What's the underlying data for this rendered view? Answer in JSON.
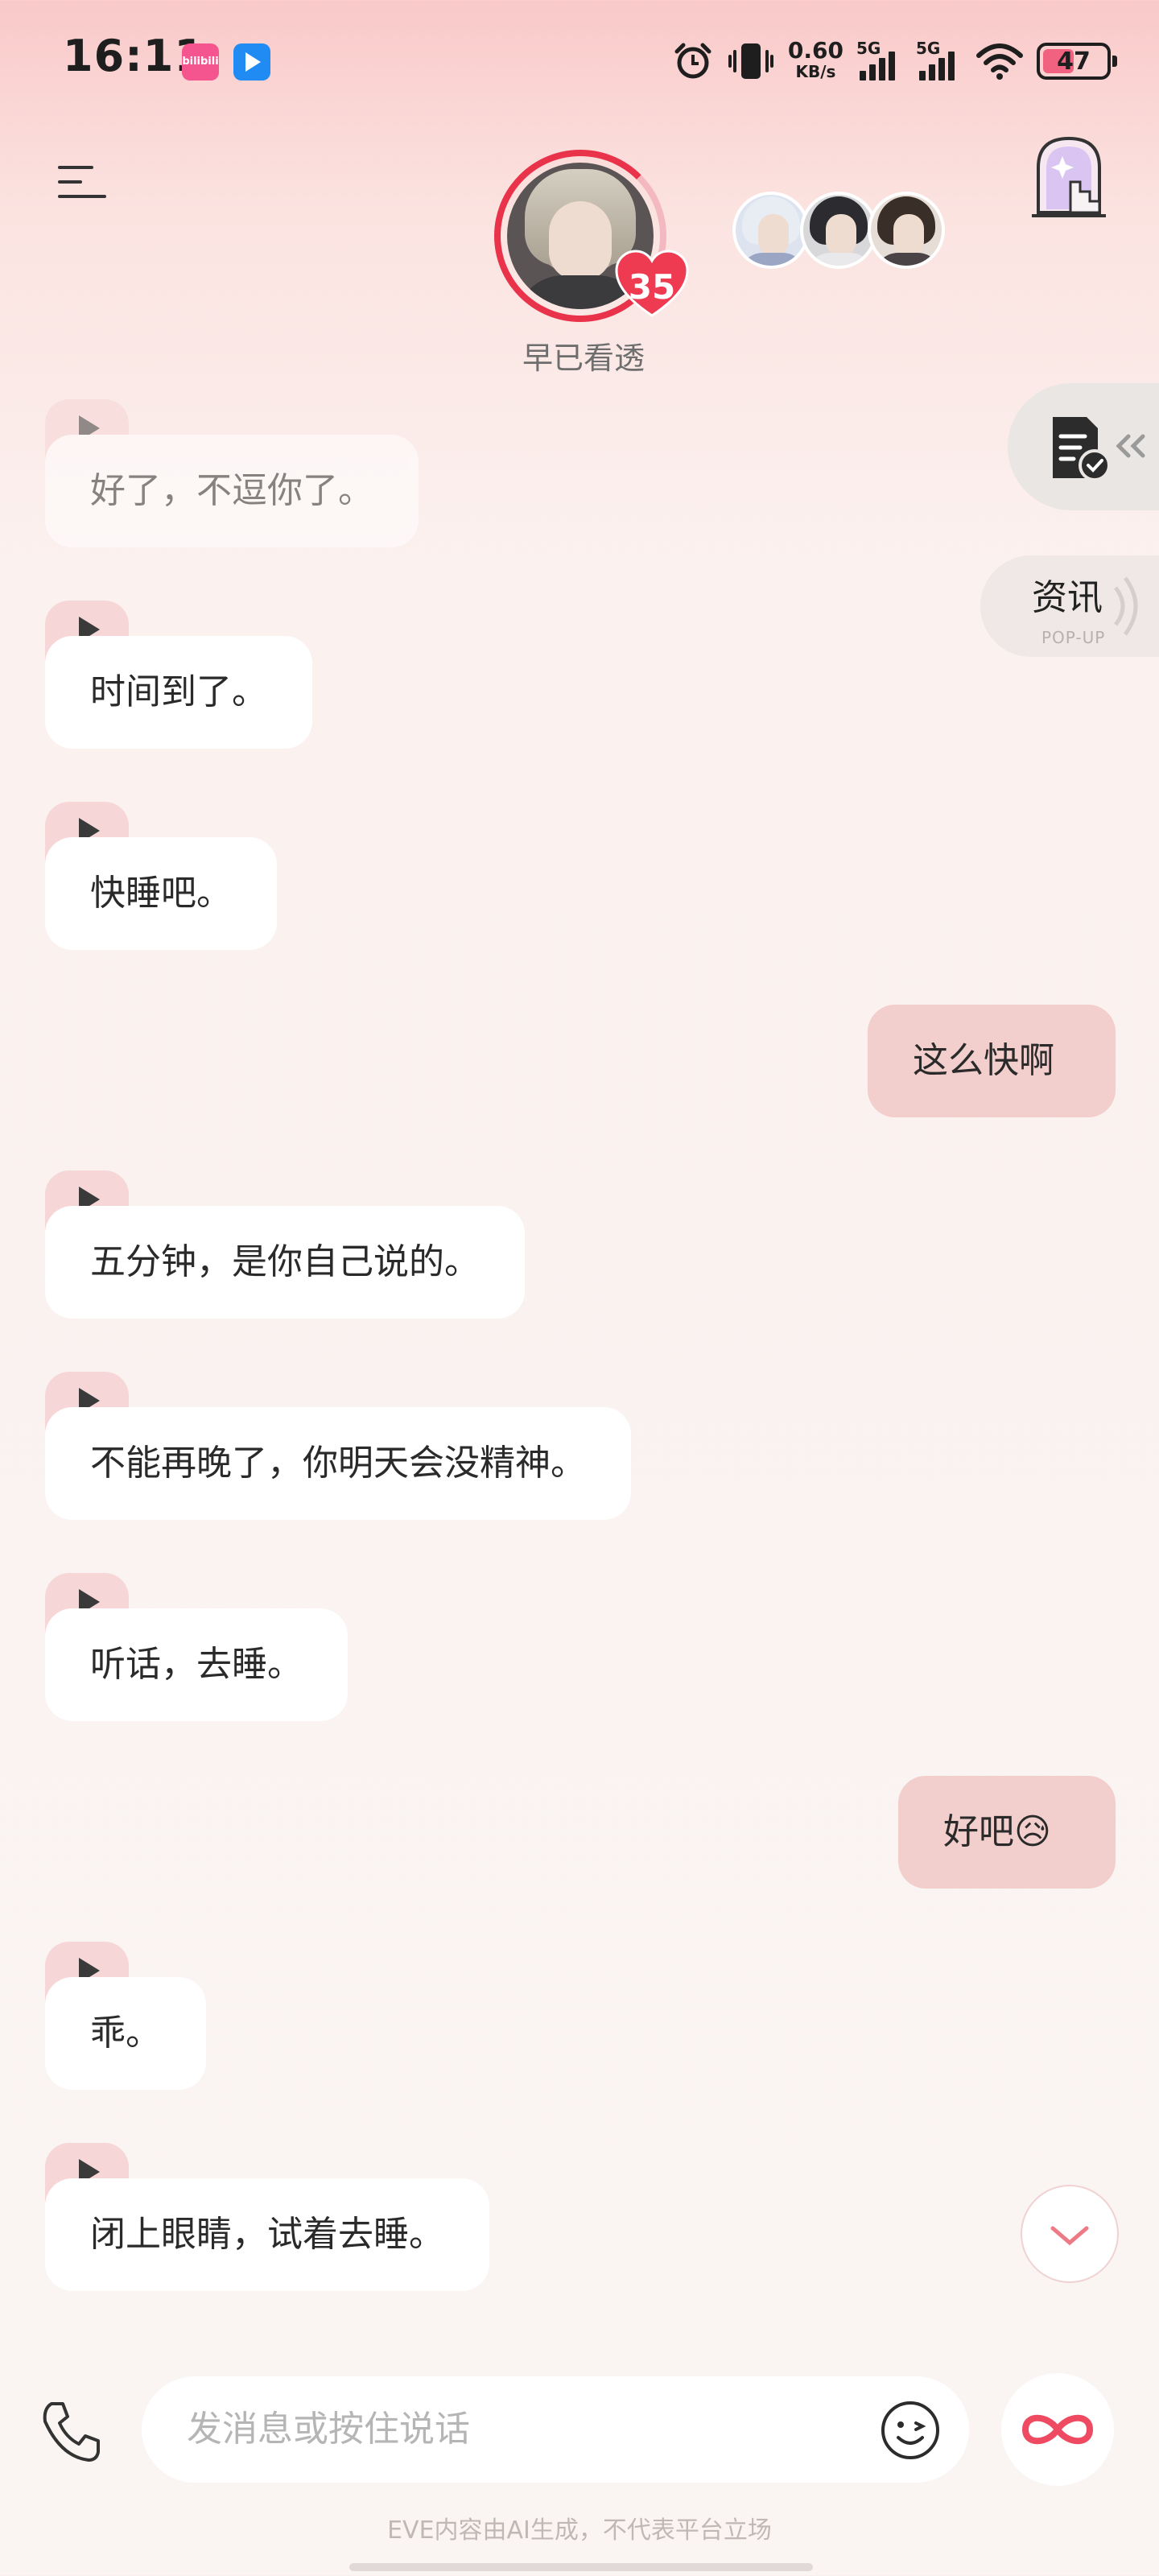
{
  "status_bar": {
    "time": "16:11",
    "app1_label": "bilibili",
    "net_speed": "0.60",
    "net_unit": "KB/s",
    "sig1_label": "5G",
    "sig2_label": "5G",
    "battery": "47"
  },
  "header": {
    "character_name": "早已看透",
    "affinity": "35"
  },
  "side": {
    "news_title": "资讯",
    "news_sub": "POP-UP"
  },
  "messages": [
    {
      "role": "ai",
      "text": "好了，不逗你了。"
    },
    {
      "role": "ai",
      "text": "时间到了。"
    },
    {
      "role": "ai",
      "text": "快睡吧。"
    },
    {
      "role": "me",
      "text": "这么快啊"
    },
    {
      "role": "ai",
      "text": "五分钟，是你自己说的。"
    },
    {
      "role": "ai",
      "text": "不能再晚了，你明天会没精神。"
    },
    {
      "role": "ai",
      "text": "听话，去睡。"
    },
    {
      "role": "me",
      "text": "好吧😥"
    },
    {
      "role": "ai",
      "text": "乖。"
    },
    {
      "role": "ai",
      "text": "闭上眼睛，试着去睡。"
    }
  ],
  "input": {
    "placeholder": "发消息或按住说话"
  },
  "footer": {
    "disclaimer": "EVE内容由AI生成，不代表平台立场"
  },
  "colors": {
    "accent": "#e8334a",
    "user_bubble": "#f2cfcd",
    "ai_bubble": "#ffffff",
    "voice_tab": "#f6d6d6"
  },
  "icons": [
    "menu-icon",
    "tower-icon",
    "task-doc-icon",
    "chevron-left-icon",
    "play-icon",
    "chevron-down-icon",
    "phone-icon",
    "emoji-icon",
    "infinity-icon",
    "alarm-icon",
    "vibrate-icon",
    "wifi-icon",
    "battery-icon"
  ]
}
